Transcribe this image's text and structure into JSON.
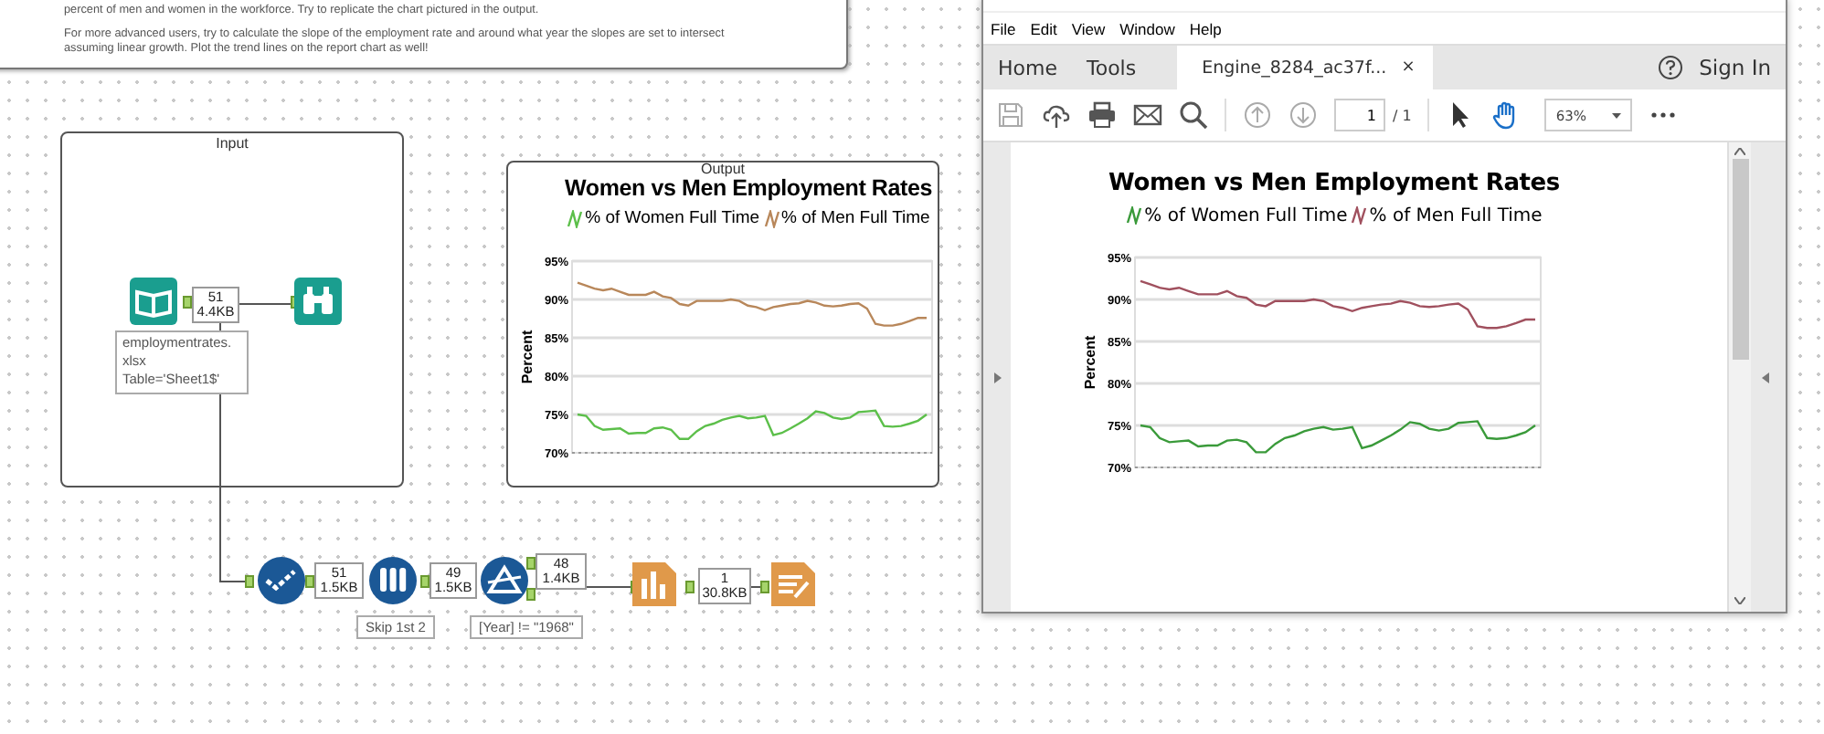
{
  "instructions": {
    "lines": [
      "percent of men and women in the workforce. Try to replicate the chart pictured in the output.",
      "For more advanced users, try to calculate the slope of the employment rate and around what year the slopes are set to intersect",
      "assuming linear growth. Plot the trend lines on the report chart as well!"
    ]
  },
  "input_container": {
    "title": "Input",
    "record_badge": {
      "count": "51",
      "size": "4.4KB"
    },
    "annotation": [
      "employmentrates.",
      "xlsx",
      "Table='Sheet1$'"
    ]
  },
  "output_container": {
    "title": "Output",
    "chart_data": {
      "type": "line",
      "grid": true,
      "legend": "top",
      "title": "Women vs Men Employment Rates",
      "ylabel": "Percent",
      "ylim": [
        70,
        95
      ],
      "yticks": [
        {
          "value": 70,
          "label": "70%"
        },
        {
          "value": 75,
          "label": "75%"
        },
        {
          "value": 80,
          "label": "80%"
        },
        {
          "value": 85,
          "label": "85%"
        },
        {
          "value": 90,
          "label": "90%"
        },
        {
          "value": 95,
          "label": "95%"
        }
      ],
      "series": [
        {
          "name": "% of Women Full Time",
          "color": "#5cbf4a",
          "values": [
            75,
            74.8,
            73.5,
            73,
            73.1,
            73.2,
            72.5,
            72.6,
            72.6,
            73.2,
            73.3,
            73,
            71.8,
            71.8,
            72.8,
            73.5,
            73.8,
            74.3,
            74.6,
            74.8,
            74.5,
            74.6,
            74.8,
            72.3,
            72.6,
            73.2,
            73.8,
            74.5,
            75.4,
            75.2,
            74.6,
            74.4,
            74.6,
            75.3,
            75.4,
            75.5,
            73.5,
            73.4,
            73.5,
            73.8,
            74.2,
            75
          ]
        },
        {
          "name": "% of Men Full Time",
          "color": "#b8875a",
          "values": [
            92.2,
            91.8,
            91.4,
            91.2,
            91.4,
            91,
            90.6,
            90.6,
            90.6,
            91,
            90.4,
            90.2,
            89.4,
            89.2,
            89.8,
            89.8,
            89.8,
            89.8,
            90,
            89.8,
            89.2,
            89,
            88.6,
            89,
            89.2,
            89.4,
            89.5,
            89.8,
            89.6,
            89.2,
            89.1,
            89.2,
            89.4,
            89.5,
            88.8,
            86.8,
            86.6,
            86.6,
            86.8,
            87.2,
            87.6,
            87.6
          ]
        }
      ]
    }
  },
  "workflow": {
    "badges": [
      {
        "count": "51",
        "size": "1.5KB"
      },
      {
        "count": "49",
        "size": "1.5KB"
      },
      {
        "count": "48",
        "size": "1.4KB"
      },
      {
        "count": "1",
        "size": "30.8KB"
      }
    ],
    "annotations": [
      "Skip 1st 2",
      "[Year] != \"1968\""
    ]
  },
  "pdf_viewer": {
    "menu": [
      "File",
      "Edit",
      "View",
      "Window",
      "Help"
    ],
    "tabs": [
      {
        "label": "Home",
        "selected": false,
        "closable": false
      },
      {
        "label": "Tools",
        "selected": false,
        "closable": false
      },
      {
        "label": "Engine_8284_ac37f...",
        "selected": true,
        "closable": true
      }
    ],
    "close_glyph": "×",
    "sign_in": "Sign In",
    "page_field": {
      "value": "1"
    },
    "page_total": "/ 1",
    "zoom": {
      "value": "63%"
    },
    "chart_data": {
      "type": "line",
      "grid": true,
      "legend": "top",
      "title": "Women vs Men Employment Rates",
      "ylabel": "Percent",
      "ylim": [
        70,
        95
      ],
      "yticks": [
        {
          "value": 70,
          "label": "70%"
        },
        {
          "value": 75,
          "label": "75%"
        },
        {
          "value": 80,
          "label": "80%"
        },
        {
          "value": 85,
          "label": "85%"
        },
        {
          "value": 90,
          "label": "90%"
        },
        {
          "value": 95,
          "label": "95%"
        }
      ],
      "series": [
        {
          "name": "% of Women Full Time",
          "color": "#3a9a3a",
          "values": [
            75,
            74.8,
            73.5,
            73,
            73.1,
            73.2,
            72.5,
            72.6,
            72.6,
            73.2,
            73.3,
            73,
            71.8,
            71.8,
            72.8,
            73.5,
            73.8,
            74.3,
            74.6,
            74.8,
            74.5,
            74.6,
            74.8,
            72.3,
            72.6,
            73.2,
            73.8,
            74.5,
            75.4,
            75.2,
            74.6,
            74.4,
            74.6,
            75.3,
            75.4,
            75.5,
            73.5,
            73.4,
            73.5,
            73.8,
            74.2,
            75
          ]
        },
        {
          "name": "% of Men Full Time",
          "color": "#a0505e",
          "values": [
            92.2,
            91.8,
            91.4,
            91.2,
            91.4,
            91,
            90.6,
            90.6,
            90.6,
            91,
            90.4,
            90.2,
            89.4,
            89.2,
            89.8,
            89.8,
            89.8,
            89.8,
            90,
            89.8,
            89.2,
            89,
            88.6,
            89,
            89.2,
            89.4,
            89.5,
            89.8,
            89.6,
            89.2,
            89.1,
            89.2,
            89.4,
            89.5,
            88.8,
            86.8,
            86.6,
            86.6,
            86.8,
            87.2,
            87.6,
            87.6
          ]
        }
      ]
    }
  }
}
